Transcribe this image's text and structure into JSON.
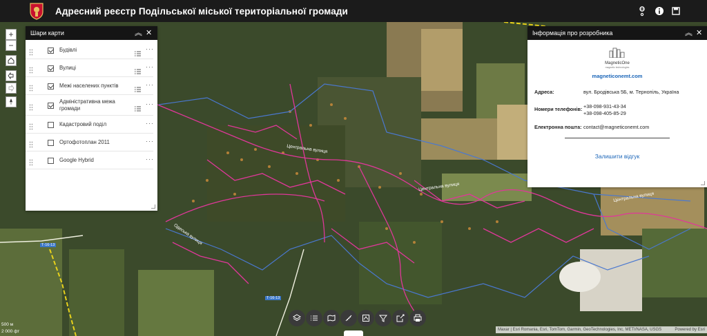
{
  "header": {
    "title": "Адресний реєстр Подільської міської територіальної громади"
  },
  "layers_panel": {
    "title": "Шари карти",
    "items": [
      {
        "label": "Будівлі",
        "checked": true
      },
      {
        "label": "Вулиці",
        "checked": true
      },
      {
        "label": "Межі населених пунктів",
        "checked": true
      },
      {
        "label": "Адміністративна межа громади",
        "checked": true
      },
      {
        "label": "Кадастровий поділ",
        "checked": false
      },
      {
        "label": "Ортофотоплан 2011",
        "checked": false
      },
      {
        "label": "Google Hybrid",
        "checked": false
      }
    ]
  },
  "developer_panel": {
    "title": "Інформація про розробника",
    "logo_text": "MagneticOne",
    "logo_subtext": "magnetic technologies",
    "website": "magneticonemt.com",
    "address_label": "Адреса:",
    "address_value": "вул. Бродівська 5Б, м. Тернопіль, Україна",
    "phones_label": "Номери телефонів:",
    "phone_1": "+38-098-931-43-34",
    "phone_2": "+38-098-405-85-29",
    "email_label": "Електронна пошта:",
    "email_value": "contact@magneticonemt.com",
    "feedback_link": "Залишити відгук"
  },
  "map": {
    "street_labels": [
      "Центральна вулиця",
      "Центральна вулиця",
      "Центральна вулиця",
      "Одеська вулиця"
    ],
    "road_shield_1": "Т-16-13",
    "road_shield_2": "Т-16-13",
    "scale_1": "500 м",
    "scale_2": "2 000 фт",
    "attribution": "Maxar | Esri Romania, Esri, TomTom, Garmin, GeoTechnologies, Inc, METI/NASA, USGS",
    "powered_by": "Powered by Esri"
  },
  "colors": {
    "header_bg": "#1b1b1b",
    "panel_header_bg": "#151515",
    "street_line": "#e0379a",
    "boundary_line": "#4a78d0",
    "admin_line": "#e8d21b",
    "link": "#1a65b8"
  }
}
